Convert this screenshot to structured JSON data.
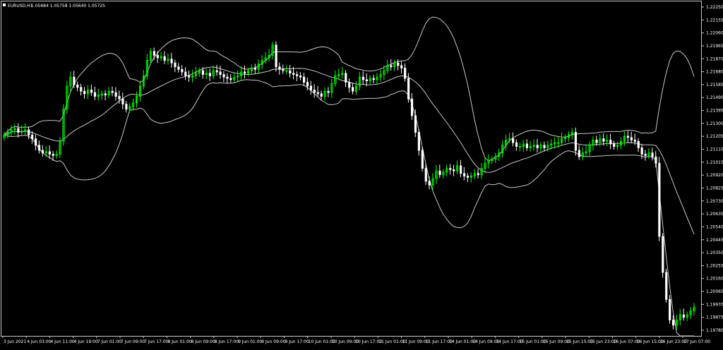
{
  "header": {
    "symbol_label": "EURUSD,H1",
    "ohlc_text": "1.05684 1.05758 1.05640 1.05725"
  },
  "chart_data": {
    "type": "candlestick",
    "title": "EURUSD,H1",
    "subtitle": "1.05684 1.05758 1.05640 1.05725",
    "xlabel": "",
    "ylabel": "",
    "ylim": [
      1.1978,
      1.22295
    ],
    "grid": false,
    "legend": "none",
    "colors": {
      "background": "#000000",
      "bull_candle": "#00ff00",
      "bear_candle": "#ffffff",
      "bands": "#c8c8c8",
      "axis": "#c8c8c8",
      "text": "#ffffff"
    },
    "y_ticks": [
      "1.22250",
      "1.22155",
      "1.22060",
      "1.21965",
      "1.21870",
      "1.21680",
      "1.21585",
      "1.21490",
      "1.21395",
      "1.21300",
      "1.21205",
      "1.21110",
      "1.21015",
      "1.20920",
      "1.20825",
      "1.20730",
      "1.20635",
      "1.20540",
      "1.20445",
      "1.20350",
      "1.20255",
      "1.20160",
      "1.20065",
      "1.19970",
      "1.19875",
      "1.19780"
    ],
    "x_ticks": [
      "3 Jun 2021",
      "4 Jun 03:00",
      "4 Jun 11:00",
      "4 Jun 19:00",
      "7 Jun 01:00",
      "7 Jun 09:00",
      "7 Jun 17:00",
      "8 Jun 01:00",
      "8 Jun 09:00",
      "8 Jun 17:00",
      "9 Jun 01:00",
      "9 Jun 09:00",
      "9 Jun 17:00",
      "10 Jun 01:00",
      "10 Jun 09:00",
      "10 Jun 17:00",
      "11 Jun 01:00",
      "11 Jun 09:00",
      "11 Jun 17:00",
      "14 Jun 01:00",
      "14 Jun 09:00",
      "14 Jun 17:00",
      "15 Jun 01:00",
      "15 Jun 09:00",
      "15 Jun 15:00",
      "15 Jun 23:00",
      "16 Jun 07:00",
      "16 Jun 15:00",
      "16 Jun 23:00",
      "17 Jun 07:00"
    ],
    "candles_close": [
      1.213,
      1.2132,
      1.2134,
      1.2135,
      1.2132,
      1.2133,
      1.2134,
      1.213,
      1.2127,
      1.2122,
      1.2118,
      1.2116,
      1.2117,
      1.2115,
      1.2114,
      1.2115,
      1.2125,
      1.215,
      1.2168,
      1.2175,
      1.2169,
      1.2167,
      1.2164,
      1.2162,
      1.2165,
      1.2163,
      1.216,
      1.2161,
      1.2162,
      1.2161,
      1.2164,
      1.2163,
      1.216,
      1.2158,
      1.2154,
      1.215,
      1.2152,
      1.2155,
      1.216,
      1.2168,
      1.2176,
      1.2188,
      1.2195,
      1.2192,
      1.219,
      1.2191,
      1.2188,
      1.2189,
      1.2186,
      1.2183,
      1.2181,
      1.2179,
      1.2176,
      1.2175,
      1.2176,
      1.2178,
      1.218,
      1.2177,
      1.2178,
      1.2176,
      1.218,
      1.2179,
      1.2177,
      1.2175,
      1.2174,
      1.2173,
      1.2175,
      1.2176,
      1.2179,
      1.2178,
      1.218,
      1.2182,
      1.2181,
      1.2185,
      1.2188,
      1.219,
      1.2192,
      1.22,
      1.2183,
      1.2181,
      1.218,
      1.218,
      1.2178,
      1.2177,
      1.2176,
      1.2175,
      1.2171,
      1.2168,
      1.2165,
      1.2163,
      1.2162,
      1.216,
      1.2164,
      1.2163,
      1.217,
      1.2176,
      1.2177,
      1.2178,
      1.2171,
      1.2167,
      1.2164,
      1.2168,
      1.2175,
      1.2173,
      1.2172,
      1.2174,
      1.2173,
      1.2175,
      1.2177,
      1.218,
      1.2184,
      1.2183,
      1.2186,
      1.2184,
      1.2182,
      1.2174,
      1.2158,
      1.2145,
      1.2132,
      1.2118,
      1.2104,
      1.2094,
      1.2091,
      1.2096,
      1.2102,
      1.2099,
      1.2101,
      1.2104,
      1.2103,
      1.2102,
      1.2106,
      1.21,
      1.2098,
      1.2097,
      1.2098,
      1.21,
      1.2099,
      1.2104,
      1.2108,
      1.211,
      1.2111,
      1.2113,
      1.2116,
      1.2122,
      1.2126,
      1.2127,
      1.2124,
      1.2121,
      1.2121,
      1.2123,
      1.212,
      1.2121,
      1.2122,
      1.212,
      1.2122,
      1.212,
      1.2122,
      1.2123,
      1.2124,
      1.2124,
      1.2127,
      1.2128,
      1.213,
      1.2132,
      1.2118,
      1.2113,
      1.2116,
      1.2117,
      1.2122,
      1.2126,
      1.2124,
      1.2127,
      1.2125,
      1.2126,
      1.2123,
      1.2121,
      1.2122,
      1.2125,
      1.2129,
      1.2128,
      1.2126,
      1.2125,
      1.212,
      1.2115,
      1.2114,
      1.2116,
      1.2113,
      1.2108,
      1.2051,
      1.2023,
      1.2002,
      1.1986,
      1.1982,
      1.1986,
      1.199,
      1.1988,
      1.199,
      1.1993,
      1.1996
    ]
  }
}
